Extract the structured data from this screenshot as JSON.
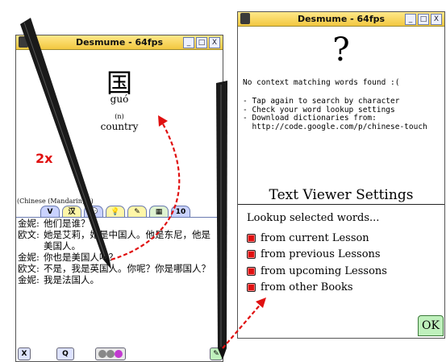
{
  "left_window": {
    "title": "Desmume - 64fps",
    "buttons": [
      "_",
      "□",
      "X"
    ],
    "character": "国",
    "pinyin": "guó",
    "part_of_speech": "(n)",
    "meaning": "country",
    "lesson_title": "(Chinese (Mandarin) 1)",
    "tabs": [
      "V",
      "汉",
      "",
      "",
      "",
      "",
      "10"
    ],
    "dialog": [
      {
        "speaker": "金妮:",
        "text": "他们是谁？"
      },
      {
        "speaker": "欧文:",
        "text": "她是艾莉，她是中国人。他是东尼，他是美国人。"
      },
      {
        "speaker": "金妮:",
        "text": "你也是美国人吗？"
      },
      {
        "speaker": "欧文:",
        "text": "不是，我是英国人。你呢？你是哪国人？"
      },
      {
        "speaker": "金妮:",
        "text": "我是法国人。"
      }
    ],
    "bottom_tools": [
      "X",
      "Q"
    ]
  },
  "right_window": {
    "title": "Desmume - 64fps",
    "buttons": [
      "_",
      "□",
      "X"
    ],
    "question_mark": "?",
    "no_match": "No context matching words found :(",
    "tips": [
      "- Tap again to search by character",
      "- Check your word lookup settings",
      "- Download dictionaries from:",
      "  http://code.google.com/p/chinese-touch"
    ],
    "settings_title": "Text Viewer Settings",
    "lookup_label": "Lookup selected words...",
    "options": [
      "from current Lesson",
      "from previous Lessons",
      "from upcoming Lessons",
      "from other Books"
    ],
    "ok_label": "OK"
  },
  "annotation": {
    "tap_count": "2x",
    "arrow_color": "#e01010"
  }
}
